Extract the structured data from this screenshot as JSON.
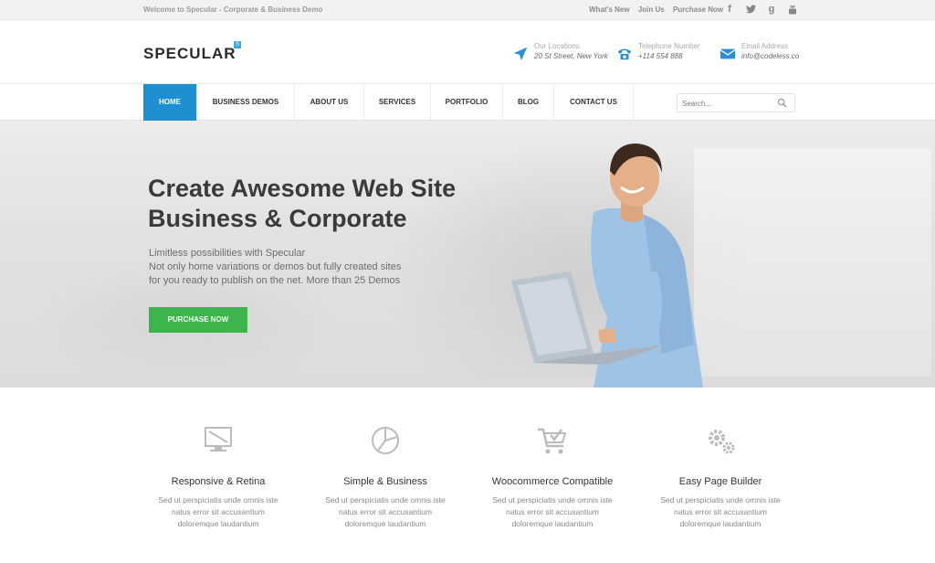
{
  "topbar": {
    "welcome": "Welcome to Specular - Corporate & Business Demo",
    "links": [
      "What's New",
      "Join Us",
      "Purchase Now"
    ],
    "social": [
      {
        "icon": "facebook-icon",
        "glyph": "f"
      },
      {
        "icon": "twitter-icon",
        "glyph": "t"
      },
      {
        "icon": "google-plus-icon",
        "glyph": "g"
      },
      {
        "icon": "youtube-icon",
        "glyph": "▶"
      }
    ]
  },
  "header": {
    "logo": "SPECULAR",
    "logo_badge": "S",
    "location_label": "Our Locations",
    "location_value": "20 St Street, New York",
    "phone_label": "Telephone Number",
    "phone_value": "+114 554 888",
    "email_label": "Email Address",
    "email_value": "info@codeless.co"
  },
  "nav": {
    "items": [
      "HOME",
      "BUSINESS DEMOS",
      "ABOUT US",
      "SERVICES",
      "PORTFOLIO",
      "BLOG",
      "CONTACT US"
    ],
    "active": "HOME",
    "search_placeholder": "Search..."
  },
  "hero": {
    "title_line1": "Create Awesome Web Site",
    "title_line2": "Business & Corporate",
    "sub_line1": "Limitless possibilities with Specular",
    "sub_line2": "Not only home variations or demos but fully created sites",
    "sub_line3": "for you ready to publish on the net. More than 25 Demos",
    "button": "PURCHASE NOW"
  },
  "features": [
    {
      "icon": "monitor-icon",
      "title": "Responsive & Retina",
      "text1": "Sed ut perspiciatis unde omnis iste",
      "text2": "natus error sit  accusantium",
      "text3": "doloremque laudantium"
    },
    {
      "icon": "pie-chart-icon",
      "title": "Simple & Business",
      "text1": "Sed ut perspiciatis unde omnis iste",
      "text2": "natus error sit  accusantium",
      "text3": "doloremque laudantium"
    },
    {
      "icon": "cart-icon",
      "title": "Woocommerce Compatible",
      "text1": "Sed ut perspiciatis unde omnis iste",
      "text2": "natus error sit  accusantium",
      "text3": "doloremque laudantium"
    },
    {
      "icon": "gears-icon",
      "title": "Easy Page Builder",
      "text1": "Sed ut perspiciatis unde omnis iste",
      "text2": "natus error sit  accusantium",
      "text3": "doloremque laudantium"
    }
  ],
  "colors": {
    "accent": "#1e8fd0",
    "button_green": "#3cb64a",
    "icon_blue": "#2b8fd6"
  }
}
